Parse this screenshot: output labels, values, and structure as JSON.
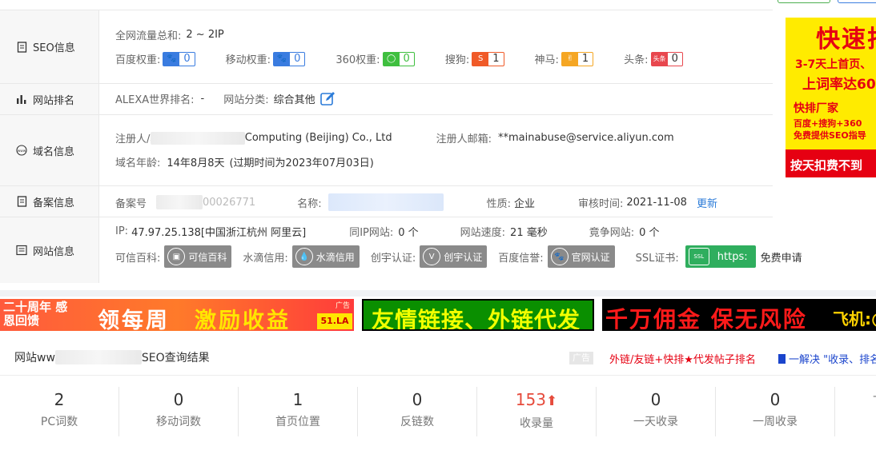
{
  "seo": {
    "label": "SEO信息",
    "traffic_key": "全网流量总和:",
    "traffic_value": "2 ~ 2IP",
    "weights": [
      {
        "key": "百度权重:",
        "value": "0",
        "icon": "paw-icon",
        "color": "#3a7ce0"
      },
      {
        "key": "移动权重:",
        "value": "0",
        "icon": "paw-icon",
        "color": "#3a7ce0"
      },
      {
        "key": "360权重:",
        "value": "0",
        "icon": "circle-icon",
        "color": "#3fbf3f"
      },
      {
        "key": "搜狗:",
        "value": "1",
        "icon": "sogou-icon",
        "color": "#f05a28"
      },
      {
        "key": "神马:",
        "value": "1",
        "icon": "shenma-icon",
        "color": "#f5a623"
      },
      {
        "key": "头条:",
        "value": "0",
        "icon": "toutiao-icon",
        "color": "#e8474e"
      }
    ]
  },
  "rank": {
    "label": "网站排名",
    "alexa_key": "ALEXA世界排名:",
    "alexa_value": "-",
    "category_key": "网站分类:",
    "category_value": "综合其他"
  },
  "domain": {
    "label": "域名信息",
    "registrant_key": "注册人/机构:",
    "registrant_value": "Computing (Beijing) Co., Ltd",
    "email_key": "注册人邮箱:",
    "email_value": "**mainabuse@service.aliyun.com",
    "age_key": "域名年龄:",
    "age_value": "14年8月8天",
    "expire_text": "(过期时间为2023年07月03日)"
  },
  "icp": {
    "label": "备案信息",
    "number_key": "备案号",
    "number_value": "00026771",
    "name_key": "名称:",
    "type_key": "性质:",
    "type_value": "企业",
    "review_key": "审核时间:",
    "review_value": "2021-11-08",
    "update_link": "更新"
  },
  "site": {
    "label": "网站信息",
    "ip_key": "IP:",
    "ip_value": "47.97.25.138[中国浙江杭州 阿里云]",
    "same_ip_key": "同IP网站:",
    "same_ip_value": "0 个",
    "speed_key": "网站速度:",
    "speed_value": "21 毫秒",
    "compete_key": "竟争网站:",
    "compete_value": "0 个",
    "certs": [
      {
        "key": "可信百科:",
        "tag": "可信百科",
        "icon": "kexin-icon"
      },
      {
        "key": "水滴信用:",
        "tag": "水滴信用",
        "icon": "drop-icon"
      },
      {
        "key": "创宇认证:",
        "tag": "创宇认证",
        "icon": "v-icon"
      },
      {
        "key": "百度信誉:",
        "tag": "官网认证",
        "icon": "paw-icon"
      }
    ],
    "ssl_key": "SSL证书:",
    "ssl_tag": "https:",
    "ssl_apply": "免费申请"
  },
  "ad_right": {
    "line1": "快速排",
    "line2": "3-7天上首页、",
    "line3": "上词率达60",
    "line4": "快排厂家",
    "line5": "百度+搜狗+360",
    "line6": "免费提供SEO指导",
    "line7": "按天扣费不到"
  },
  "banners": {
    "b1_left": "二十周年 感恩回馈",
    "b1_mid": "领每周",
    "b1_right": "激励收益",
    "b1_ad": "广告",
    "b1_logo": "51.LA",
    "b2": "友情链接、外链代发",
    "b3_main": "千万佣金  保无风险",
    "b3_side": "飞机:@"
  },
  "results": {
    "title_prefix": "网站ww",
    "title_suffix": "SEO查询结果",
    "ad_tag": "广告",
    "ad_link1": "外链/友链+快排★代发帖子排名",
    "ad_link2": "一解决 \"收录、排名"
  },
  "stats": [
    {
      "value": "2",
      "label": "PC词数"
    },
    {
      "value": "0",
      "label": "移动词数"
    },
    {
      "value": "1",
      "label": "首页位置"
    },
    {
      "value": "0",
      "label": "反链数"
    },
    {
      "value": "153",
      "label": "收录量",
      "trend": "up"
    },
    {
      "value": "0",
      "label": "一天收录"
    },
    {
      "value": "0",
      "label": "一周收录"
    },
    {
      "value": "",
      "label": "-"
    }
  ]
}
